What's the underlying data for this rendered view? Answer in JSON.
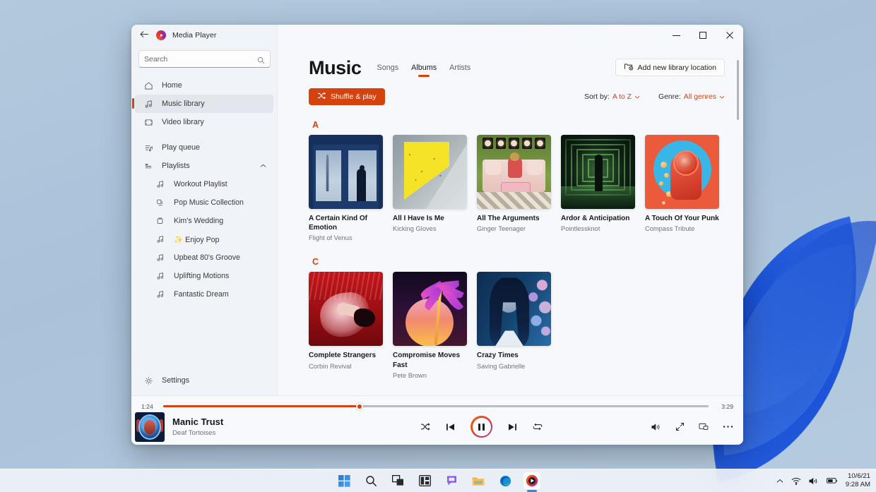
{
  "window": {
    "app_title": "Media Player",
    "back_icon": "back-arrow-icon",
    "logo_icon": "media-player-logo-icon",
    "minimize_label": "–",
    "maximize_label": "☐",
    "close_label": "✕"
  },
  "search": {
    "placeholder": "Search",
    "icon": "search-icon"
  },
  "sidebar": {
    "items": [
      {
        "label": "Home",
        "icon": "home-icon",
        "active": false
      },
      {
        "label": "Music library",
        "icon": "music-note-icon",
        "active": true
      },
      {
        "label": "Video library",
        "icon": "video-icon",
        "active": false
      },
      {
        "label": "Play queue",
        "icon": "queue-icon",
        "active": false
      },
      {
        "label": "Playlists",
        "icon": "playlists-icon",
        "active": false,
        "expanded": true
      }
    ],
    "playlists": [
      {
        "label": "Workout Playlist",
        "icon": "music-note-icon"
      },
      {
        "label": "Pop Music Collection",
        "icon": "playlist-grid-icon"
      },
      {
        "label": "Kim's Wedding",
        "icon": "folder-playlist-icon"
      },
      {
        "label": "✨ Enjoy Pop",
        "icon": "music-note-icon"
      },
      {
        "label": "Upbeat 80's Groove",
        "icon": "music-note-icon"
      },
      {
        "label": "Uplifting Motions",
        "icon": "music-note-icon"
      },
      {
        "label": "Fantastic Dream",
        "icon": "music-note-icon"
      }
    ],
    "settings": {
      "label": "Settings",
      "icon": "gear-icon"
    },
    "collapse_chevron": "chevron-up-icon"
  },
  "main": {
    "page_title": "Music",
    "tabs": [
      {
        "label": "Songs",
        "active": false
      },
      {
        "label": "Albums",
        "active": true
      },
      {
        "label": "Artists",
        "active": false
      }
    ],
    "add_library_button": {
      "label": "Add new library location",
      "icon": "add-folder-icon"
    },
    "shuffle_button": {
      "label": "Shuffle & play",
      "icon": "shuffle-icon"
    },
    "filters": [
      {
        "name": "Sort by:",
        "value": "A to Z",
        "chevron": "chevron-down-icon"
      },
      {
        "name": "Genre:",
        "value": "All genres",
        "chevron": "chevron-down-icon"
      }
    ],
    "sections": [
      {
        "letter": "A",
        "albums": [
          {
            "title": "A Certain Kind Of Emotion",
            "artist": "Flight of Venus",
            "art": "window"
          },
          {
            "title": "All I Have Is Me",
            "artist": "Kicking Gloves",
            "art": "yellow"
          },
          {
            "title": "All The Arguments",
            "artist": "Ginger Teenager",
            "art": "green-room"
          },
          {
            "title": "Ardor & Anticipation",
            "artist": "Pointlessknot",
            "art": "corridor"
          },
          {
            "title": "A Touch Of Your Punk",
            "artist": "Compass Tribute",
            "art": "astro"
          }
        ]
      },
      {
        "letter": "C",
        "albums": [
          {
            "title": "Complete Strangers",
            "artist": "Corbin Revival",
            "art": "red-water"
          },
          {
            "title": "Compromise Moves Fast",
            "artist": "Pete Brown",
            "art": "palm"
          },
          {
            "title": "Crazy Times",
            "artist": "Saving Gabrielle",
            "art": "blue-girl"
          }
        ]
      }
    ]
  },
  "player": {
    "elapsed": "1:24",
    "duration": "3:29",
    "progress_percent": 36,
    "track_title": "Manic Trust",
    "track_artist": "Deaf Tortoises",
    "shuffle_icon": "shuffle-icon",
    "previous_icon": "previous-track-icon",
    "play_pause_icon": "pause-icon",
    "next_icon": "next-track-icon",
    "repeat_icon": "repeat-icon",
    "volume_icon": "volume-icon",
    "fullscreen_icon": "fullscreen-icon",
    "miniplayer_icon": "mini-player-icon",
    "more_icon": "more-options-icon"
  },
  "taskbar": {
    "icons": [
      {
        "name": "start-icon",
        "active": false
      },
      {
        "name": "search-icon",
        "active": false
      },
      {
        "name": "task-view-icon",
        "active": false
      },
      {
        "name": "widgets-icon",
        "active": false
      },
      {
        "name": "chat-icon",
        "active": false
      },
      {
        "name": "file-explorer-icon",
        "active": false
      },
      {
        "name": "edge-icon",
        "active": false
      },
      {
        "name": "media-player-icon",
        "active": true
      }
    ],
    "tray": {
      "chevron_icon": "chevron-up-icon",
      "wifi_icon": "wifi-icon",
      "volume_icon": "volume-icon",
      "battery_icon": "battery-icon",
      "date": "10/6/21",
      "time": "9:28 AM"
    }
  },
  "colors": {
    "accent": "#d6420e",
    "window_bg": "#f6f8fb",
    "sidebar_bg": "#f0f3f7",
    "desktop": "#afc6dc"
  }
}
